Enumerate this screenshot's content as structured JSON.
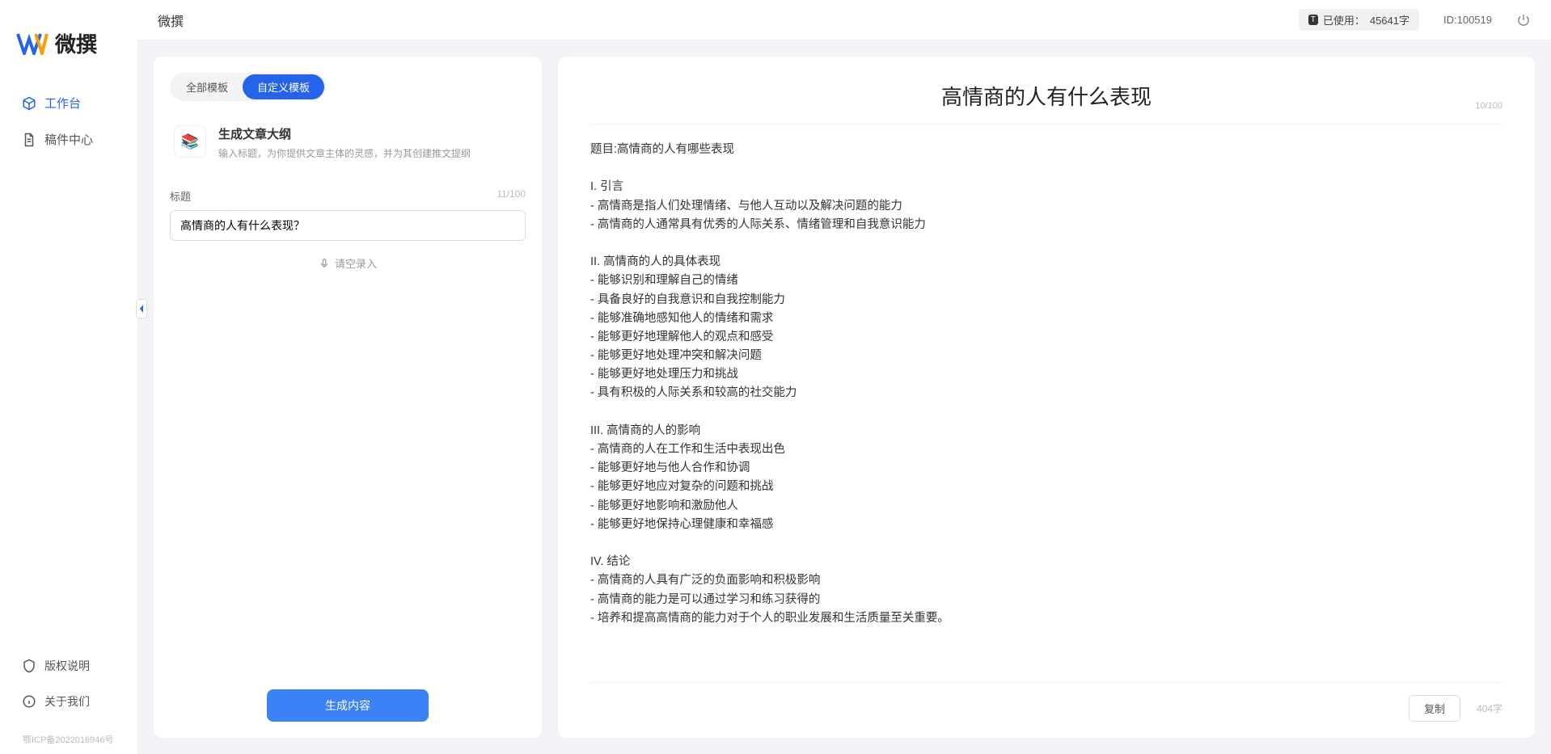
{
  "app": {
    "name": "微撰",
    "icp": "鄂ICP备2022016946号"
  },
  "nav": {
    "workspace": "工作台",
    "drafts": "稿件中心",
    "copyright": "版权说明",
    "about": "关于我们"
  },
  "topbar": {
    "title": "微撰",
    "usage_prefix": "已使用：",
    "usage_value": "45641字",
    "id_label": "ID:100519",
    "usage_badge": "T"
  },
  "left": {
    "tabs": {
      "all": "全部模板",
      "custom": "自定义模板"
    },
    "template": {
      "title": "生成文章大纲",
      "desc": "输入标题，为你提供文章主体的灵感，并为其创建推文提纲"
    },
    "field_label": "标题",
    "field_count": "11/100",
    "input_value": "高情商的人有什么表现？",
    "voice_hint": "请空录入",
    "generate": "生成内容"
  },
  "right": {
    "title": "高情商的人有什么表现",
    "header_count": "10/100",
    "body": "题目:高情商的人有哪些表现\n\nI. 引言\n- 高情商是指人们处理情绪、与他人互动以及解决问题的能力\n- 高情商的人通常具有优秀的人际关系、情绪管理和自我意识能力\n\nII. 高情商的人的具体表现\n- 能够识别和理解自己的情绪\n- 具备良好的自我意识和自我控制能力\n- 能够准确地感知他人的情绪和需求\n- 能够更好地理解他人的观点和感受\n- 能够更好地处理冲突和解决问题\n- 能够更好地处理压力和挑战\n- 具有积极的人际关系和较高的社交能力\n\nIII. 高情商的人的影响\n- 高情商的人在工作和生活中表现出色\n- 能够更好地与他人合作和协调\n- 能够更好地应对复杂的问题和挑战\n- 能够更好地影响和激励他人\n- 能够更好地保持心理健康和幸福感\n\nIV. 结论\n- 高情商的人具有广泛的负面影响和积极影响\n- 高情商的能力是可以通过学习和练习获得的\n- 培养和提高高情商的能力对于个人的职业发展和生活质量至关重要。",
    "copy": "复制",
    "char_count": "404字"
  }
}
